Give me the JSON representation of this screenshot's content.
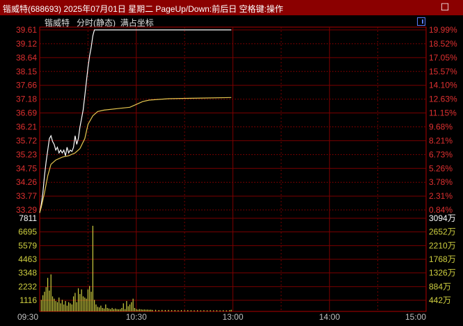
{
  "window": {
    "title": "锴威特(688693) 2025年07月01日 星期二 PageUp/Down:前后日 空格键:操作",
    "close_icon": "close-icon"
  },
  "panel": {
    "stock_name": "锴威特",
    "mode": "分时(静态)",
    "option": "满占坐标"
  },
  "colors": {
    "price_line": "#ffffff",
    "avg_line": "#e8c850",
    "axis_text": "#e03030",
    "volume_text": "#d0d040",
    "volume_bar": "#d0d040",
    "grid": "#7a0000",
    "axis_frame": "#b00000",
    "time_text": "#c0c0c0"
  },
  "chart_data": {
    "type": "line",
    "price_axis": {
      "left_labels": [
        "39.61",
        "39.12",
        "38.64",
        "38.15",
        "37.66",
        "37.18",
        "36.69",
        "36.21",
        "35.72",
        "35.23",
        "34.75",
        "34.26",
        "33.77",
        "33.29"
      ],
      "right_labels": [
        "19.99%",
        "18.52%",
        "17.05%",
        "15.57%",
        "14.10%",
        "12.63%",
        "11.15%",
        "9.68%",
        "8.21%",
        "6.73%",
        "5.26%",
        "3.78%",
        "2.31%",
        "0.84%"
      ],
      "ylim": [
        33.01,
        39.61
      ]
    },
    "volume_axis": {
      "left_labels": [
        "7811",
        "6695",
        "5579",
        "4463",
        "3348",
        "2232",
        "1116"
      ],
      "right_labels": [
        "3094万",
        "2652万",
        "2210万",
        "1768万",
        "1326万",
        "884万",
        "442万"
      ],
      "ylim": [
        0,
        7811
      ]
    },
    "time_labels": [
      "09:30",
      "10:30",
      "13:00",
      "14:00",
      "15:00"
    ],
    "total_minutes": 240,
    "series": [
      {
        "key": "price",
        "points": [
          [
            0,
            33.2
          ],
          [
            1,
            33.5
          ],
          [
            2,
            33.9
          ],
          [
            3,
            34.5
          ],
          [
            4,
            35.0
          ],
          [
            5,
            35.4
          ],
          [
            6,
            35.8
          ],
          [
            7,
            35.9
          ],
          [
            8,
            35.7
          ],
          [
            9,
            35.6
          ],
          [
            10,
            35.4
          ],
          [
            11,
            35.5
          ],
          [
            12,
            35.3
          ],
          [
            13,
            35.4
          ],
          [
            14,
            35.3
          ],
          [
            15,
            35.4
          ],
          [
            16,
            35.2
          ],
          [
            17,
            35.5
          ],
          [
            18,
            35.3
          ],
          [
            19,
            35.4
          ],
          [
            20,
            35.35
          ],
          [
            21,
            35.5
          ],
          [
            22,
            35.9
          ],
          [
            23,
            35.6
          ],
          [
            24,
            35.8
          ],
          [
            25,
            36.2
          ],
          [
            26,
            36.5
          ],
          [
            27,
            36.8
          ],
          [
            28,
            37.3
          ],
          [
            29,
            37.8
          ],
          [
            30,
            38.3
          ],
          [
            31,
            38.7
          ],
          [
            32,
            39.0
          ],
          [
            33,
            39.4
          ],
          [
            34,
            39.61
          ],
          [
            80,
            39.61
          ],
          [
            119,
            39.61
          ]
        ]
      },
      {
        "key": "avg",
        "points": [
          [
            0,
            33.2
          ],
          [
            1,
            33.4
          ],
          [
            3,
            33.9
          ],
          [
            5,
            34.5
          ],
          [
            7,
            34.9
          ],
          [
            10,
            35.05
          ],
          [
            14,
            35.15
          ],
          [
            18,
            35.2
          ],
          [
            22,
            35.3
          ],
          [
            25,
            35.45
          ],
          [
            28,
            35.8
          ],
          [
            30,
            36.3
          ],
          [
            33,
            36.6
          ],
          [
            36,
            36.75
          ],
          [
            40,
            36.8
          ],
          [
            48,
            36.85
          ],
          [
            56,
            36.9
          ],
          [
            60,
            37.0
          ],
          [
            64,
            37.1
          ],
          [
            68,
            37.15
          ],
          [
            80,
            37.2
          ],
          [
            100,
            37.22
          ],
          [
            119,
            37.24
          ]
        ]
      }
    ],
    "volume": [
      [
        1,
        1000
      ],
      [
        2,
        1400
      ],
      [
        3,
        1700
      ],
      [
        4,
        2100
      ],
      [
        5,
        2900
      ],
      [
        6,
        1800
      ],
      [
        7,
        3200
      ],
      [
        8,
        1300
      ],
      [
        9,
        1100
      ],
      [
        10,
        900
      ],
      [
        11,
        800
      ],
      [
        12,
        1200
      ],
      [
        13,
        700
      ],
      [
        14,
        1000
      ],
      [
        15,
        600
      ],
      [
        16,
        900
      ],
      [
        17,
        500
      ],
      [
        18,
        800
      ],
      [
        19,
        700
      ],
      [
        20,
        600
      ],
      [
        21,
        1300
      ],
      [
        22,
        1600
      ],
      [
        23,
        800
      ],
      [
        24,
        2000
      ],
      [
        25,
        1500
      ],
      [
        26,
        1900
      ],
      [
        27,
        1300
      ],
      [
        28,
        1200
      ],
      [
        29,
        1100
      ],
      [
        30,
        1900
      ],
      [
        31,
        2200
      ],
      [
        32,
        1700
      ],
      [
        33,
        7400
      ],
      [
        34,
        1000
      ],
      [
        35,
        600
      ],
      [
        36,
        400
      ],
      [
        37,
        350
      ],
      [
        38,
        500
      ],
      [
        39,
        300
      ],
      [
        40,
        250
      ],
      [
        41,
        600
      ],
      [
        42,
        300
      ],
      [
        43,
        250
      ],
      [
        44,
        200
      ],
      [
        45,
        300
      ],
      [
        46,
        200
      ],
      [
        47,
        250
      ],
      [
        48,
        200
      ],
      [
        49,
        180
      ],
      [
        50,
        200
      ],
      [
        51,
        300
      ],
      [
        52,
        700
      ],
      [
        53,
        200
      ],
      [
        54,
        900
      ],
      [
        55,
        450
      ],
      [
        56,
        600
      ],
      [
        57,
        800
      ],
      [
        58,
        1100
      ],
      [
        59,
        300
      ],
      [
        60,
        200
      ],
      [
        61,
        150
      ],
      [
        62,
        200
      ],
      [
        63,
        180
      ],
      [
        64,
        150
      ],
      [
        65,
        170
      ],
      [
        66,
        150
      ],
      [
        67,
        160
      ],
      [
        68,
        140
      ],
      [
        69,
        150
      ],
      [
        70,
        130
      ],
      [
        72,
        140
      ],
      [
        74,
        120
      ],
      [
        76,
        130
      ],
      [
        78,
        120
      ],
      [
        80,
        130
      ],
      [
        82,
        110
      ],
      [
        84,
        120
      ],
      [
        86,
        100
      ],
      [
        88,
        110
      ],
      [
        90,
        100
      ],
      [
        92,
        110
      ],
      [
        94,
        100
      ],
      [
        96,
        90
      ],
      [
        98,
        100
      ],
      [
        100,
        90
      ],
      [
        102,
        100
      ],
      [
        104,
        90
      ],
      [
        106,
        100
      ],
      [
        108,
        90
      ],
      [
        110,
        100
      ],
      [
        112,
        90
      ],
      [
        114,
        100
      ],
      [
        116,
        90
      ],
      [
        118,
        110
      ],
      [
        119,
        140
      ]
    ]
  }
}
